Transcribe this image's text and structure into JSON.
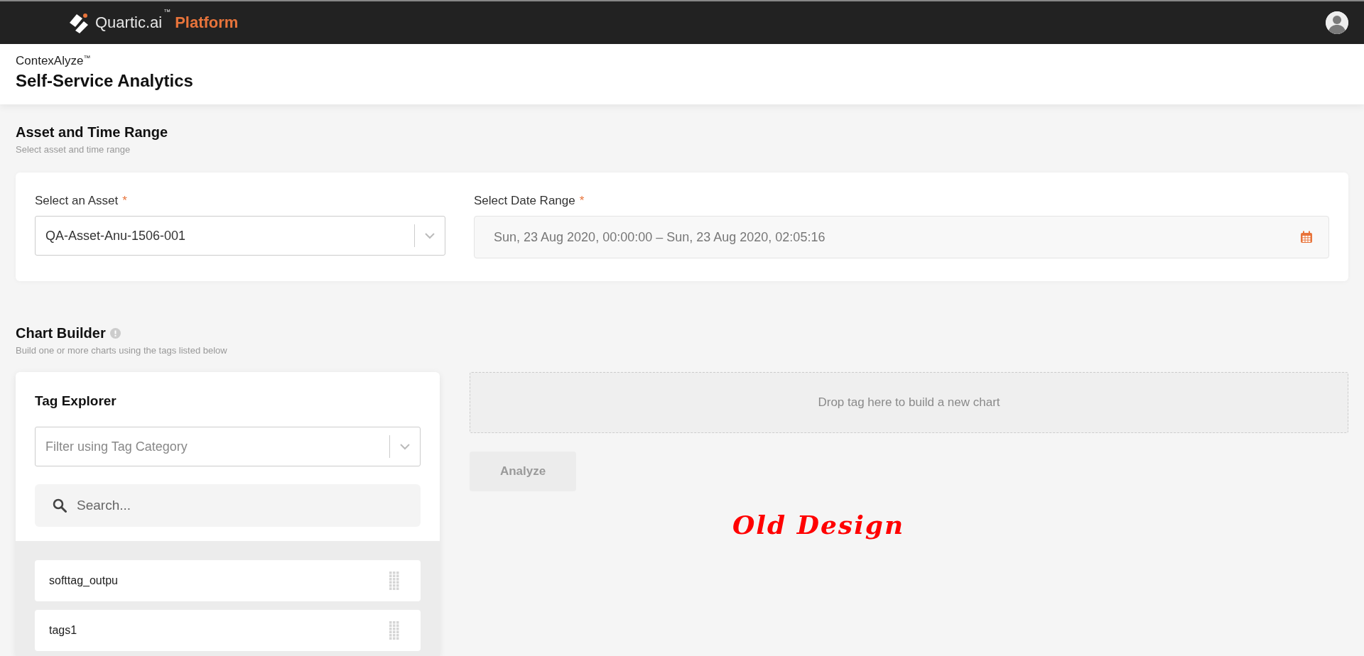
{
  "header": {
    "brand": "Quartic.ai",
    "trademark": "™",
    "product": "Platform"
  },
  "page": {
    "app_name": "ContexAlyze",
    "app_trademark": "™",
    "title": "Self-Service Analytics"
  },
  "asset_section": {
    "title": "Asset and Time Range",
    "subtitle": "Select asset and time range",
    "asset_label": "Select an Asset",
    "asset_required": "*",
    "asset_value": "QA-Asset-Anu-1506-001",
    "date_label": "Select Date Range",
    "date_required": "*",
    "date_value": "Sun, 23 Aug 2020, 00:00:00 – Sun, 23 Aug 2020, 02:05:16"
  },
  "chart_builder": {
    "title": "Chart Builder",
    "subtitle": "Build one or more charts using the tags listed below",
    "tag_explorer": {
      "title": "Tag Explorer",
      "filter_placeholder": "Filter using Tag Category",
      "search_placeholder": "Search...",
      "tags": [
        {
          "label": "softtag_outpu"
        },
        {
          "label": "tags1"
        }
      ]
    },
    "drop_zone": "Drop tag here to build a new chart",
    "analyze_button": {
      "label": "Analyze",
      "disabled": true
    }
  },
  "annotation": "Old Design"
}
